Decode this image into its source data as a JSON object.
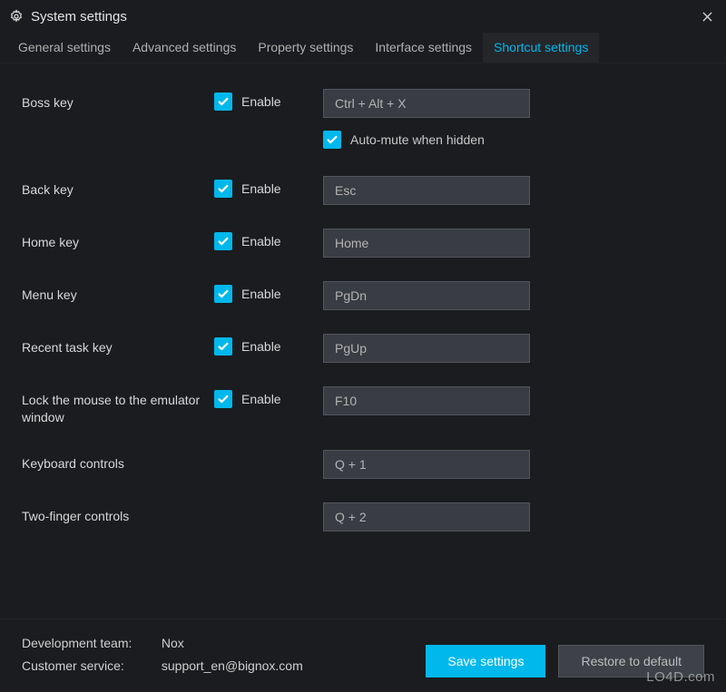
{
  "window": {
    "title": "System settings"
  },
  "tabs": [
    {
      "label": "General settings"
    },
    {
      "label": "Advanced settings"
    },
    {
      "label": "Property settings"
    },
    {
      "label": "Interface settings"
    },
    {
      "label": "Shortcut settings",
      "active": true
    }
  ],
  "common": {
    "enable_label": "Enable"
  },
  "rows": {
    "boss": {
      "label": "Boss key",
      "value": "Ctrl + Alt + X",
      "automute": "Auto-mute when hidden"
    },
    "back": {
      "label": "Back key",
      "value": "Esc"
    },
    "home": {
      "label": "Home key",
      "value": "Home"
    },
    "menu": {
      "label": "Menu key",
      "value": "PgDn"
    },
    "recent": {
      "label": "Recent task key",
      "value": "PgUp"
    },
    "lock": {
      "label": "Lock the mouse to the emulator window",
      "value": "F10"
    },
    "keyboard": {
      "label": "Keyboard controls",
      "value": "Q + 1"
    },
    "twofinger": {
      "label": "Two-finger controls",
      "value": "Q + 2"
    }
  },
  "footer": {
    "dev_label": "Development team:",
    "dev_value": "Nox",
    "cs_label": "Customer service:",
    "cs_value": "support_en@bignox.com",
    "save": "Save settings",
    "restore": "Restore to default"
  },
  "watermark": "LO4D.com"
}
